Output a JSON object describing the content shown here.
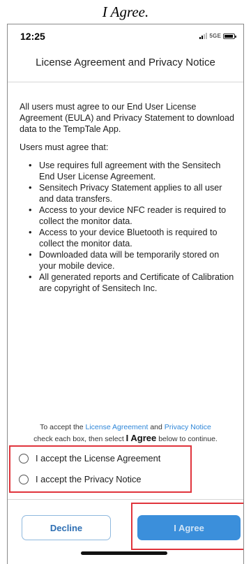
{
  "caption": "I Agree.",
  "status_bar": {
    "time": "12:25",
    "network": "5GE"
  },
  "header": {
    "title": "License Agreement and Privacy Notice"
  },
  "body": {
    "intro": "All users must agree to our End User License Agreement (EULA) and Privacy Statement to download data to the TempTale App.",
    "subheading": "Users must agree that:",
    "bullets": [
      "Use requires full agreement with the Sensitech End User License Agreement.",
      "Sensitech Privacy Statement applies to all user and data transfers.",
      "Access to your device NFC reader is required to collect the monitor data.",
      "Access to your device Bluetooth is required to collect the monitor data.",
      "Downloaded data will be temporarily stored on your mobile device.",
      "All generated reports and Certificate of Calibration are copyright of Sensitech Inc."
    ]
  },
  "accept_note": {
    "pre": "To accept the",
    "license_link": "License Agreement",
    "and": "and",
    "privacy_link": "Privacy Notice",
    "mid": "check each box, then select",
    "agree_word": "I Agree",
    "post": "below to continue."
  },
  "checkboxes": [
    {
      "label": "I accept the License Agreement",
      "checked": false
    },
    {
      "label": "I accept the Privacy Notice",
      "checked": false
    }
  ],
  "buttons": {
    "decline": "Decline",
    "agree": "I Agree"
  },
  "colors": {
    "accent": "#3b8fdb",
    "link": "#2e86d8",
    "highlight": "#e0343c"
  }
}
